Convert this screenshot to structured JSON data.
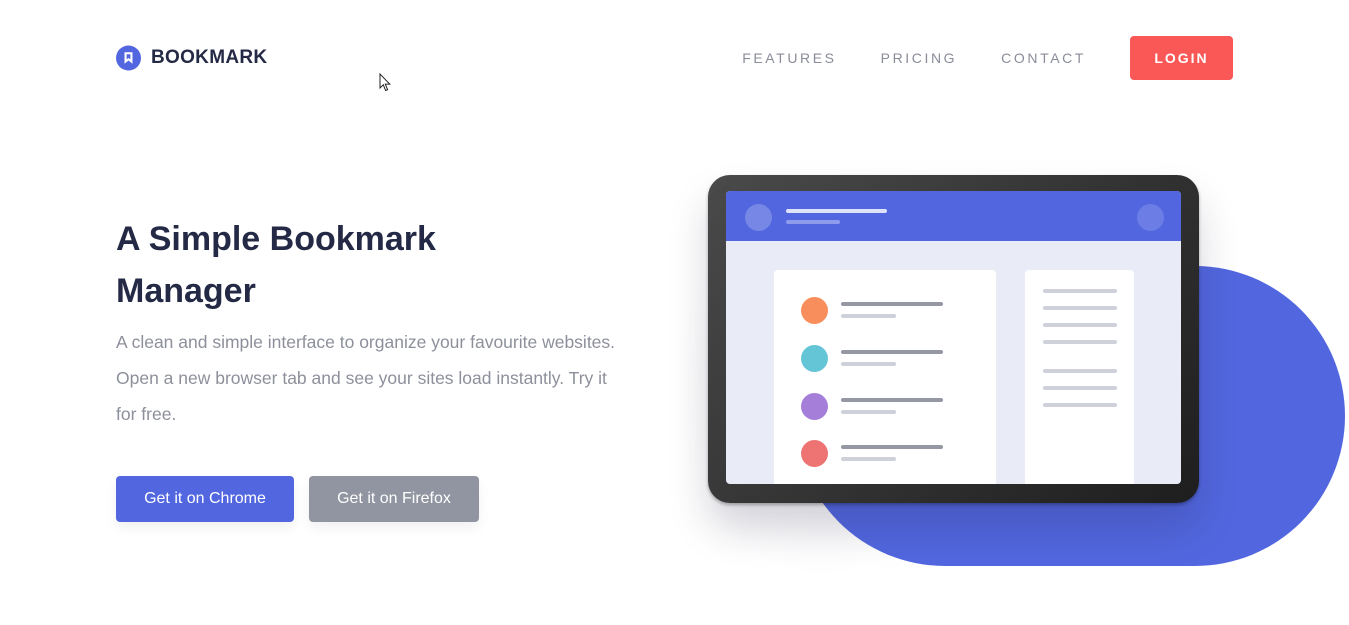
{
  "brand": {
    "name": "BOOKMARK",
    "icon": "bookmark-logo-icon",
    "color": "#5267df"
  },
  "nav": {
    "links": [
      "FEATURES",
      "PRICING",
      "CONTACT"
    ],
    "login_label": "LOGIN",
    "login_color": "#fa5757"
  },
  "hero": {
    "title_line1": "A Simple Bookmark",
    "title_line2": "Manager",
    "description": "A clean and simple interface to organize your favourite websites. Open a new browser tab and see your sites load instantly. Try it for free.",
    "chrome_button": "Get it on Chrome",
    "firefox_button": "Get it on Firefox",
    "chrome_color": "#5267df",
    "firefox_color": "#9194a1"
  },
  "illustration": {
    "item_colors": [
      "#f88e5b",
      "#64c5d6",
      "#a57ed9",
      "#ed7473"
    ],
    "accent": "#5267df"
  }
}
